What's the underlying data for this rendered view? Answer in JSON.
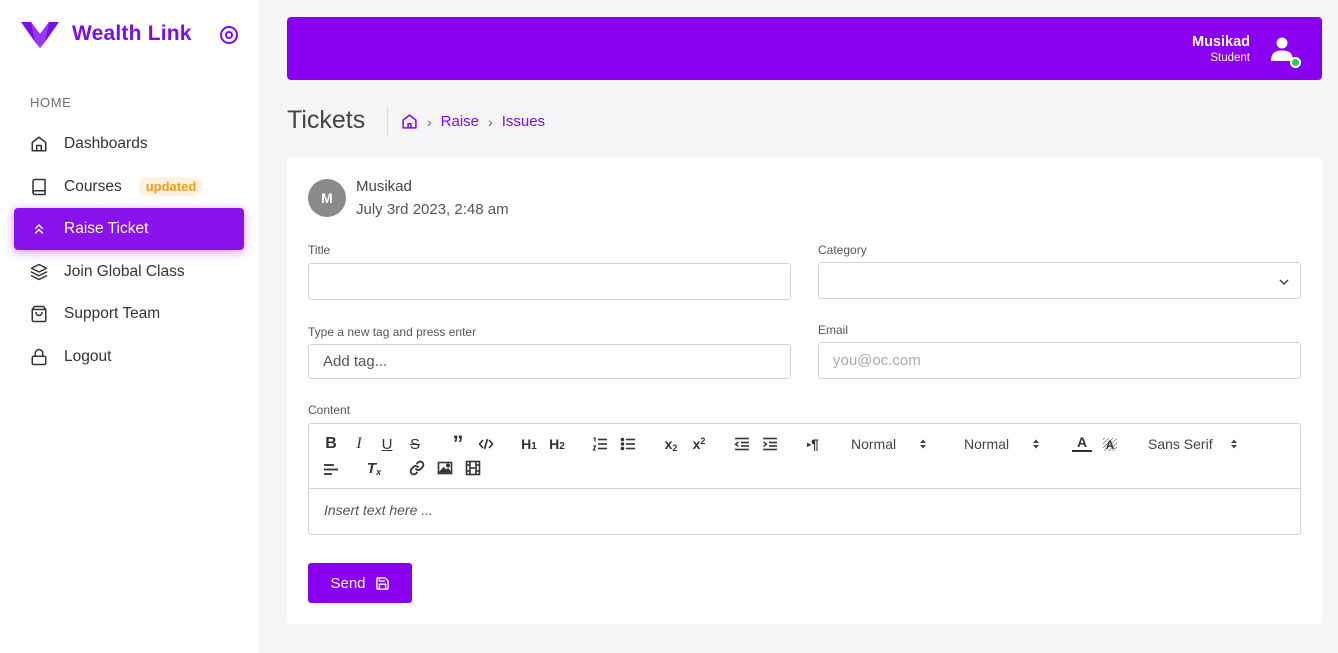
{
  "brand": {
    "name": "Wealth Link",
    "color": "#7b0ee6"
  },
  "sidebar": {
    "section_label": "HOME",
    "items": [
      {
        "label": "Dashboards",
        "icon": "home-icon",
        "active": false
      },
      {
        "label": "Courses",
        "icon": "book-icon",
        "badge": "updated",
        "active": false
      },
      {
        "label": "Raise Ticket",
        "icon": "chevrons-up-icon",
        "active": true
      },
      {
        "label": "Join Global Class",
        "icon": "layers-icon",
        "active": false
      },
      {
        "label": "Support Team",
        "icon": "shopping-bag-icon",
        "active": false
      },
      {
        "label": "Logout",
        "icon": "lock-icon",
        "active": false
      }
    ]
  },
  "header": {
    "user_name": "Musikad",
    "user_role": "Student",
    "bg_color": "#8a00f0",
    "status_color": "#1fcf5a"
  },
  "page": {
    "title": "Tickets",
    "breadcrumb": [
      "Raise",
      "Issues"
    ]
  },
  "ticket": {
    "avatar_initial": "M",
    "author": "Musikad",
    "date": "July 3rd 2023, 2:48 am",
    "fields": {
      "title_label": "Title",
      "title_value": "",
      "category_label": "Category",
      "category_value": "",
      "tags_label": "Type a new tag and press enter",
      "tags_placeholder": "Add tag...",
      "email_label": "Email",
      "email_placeholder": "you@oc.com",
      "content_label": "Content",
      "content_placeholder": "Insert text here ..."
    },
    "toolbar": {
      "header_select": "Normal",
      "size_select": "Normal",
      "font_select": "Sans Serif"
    },
    "send_label": "Send"
  }
}
